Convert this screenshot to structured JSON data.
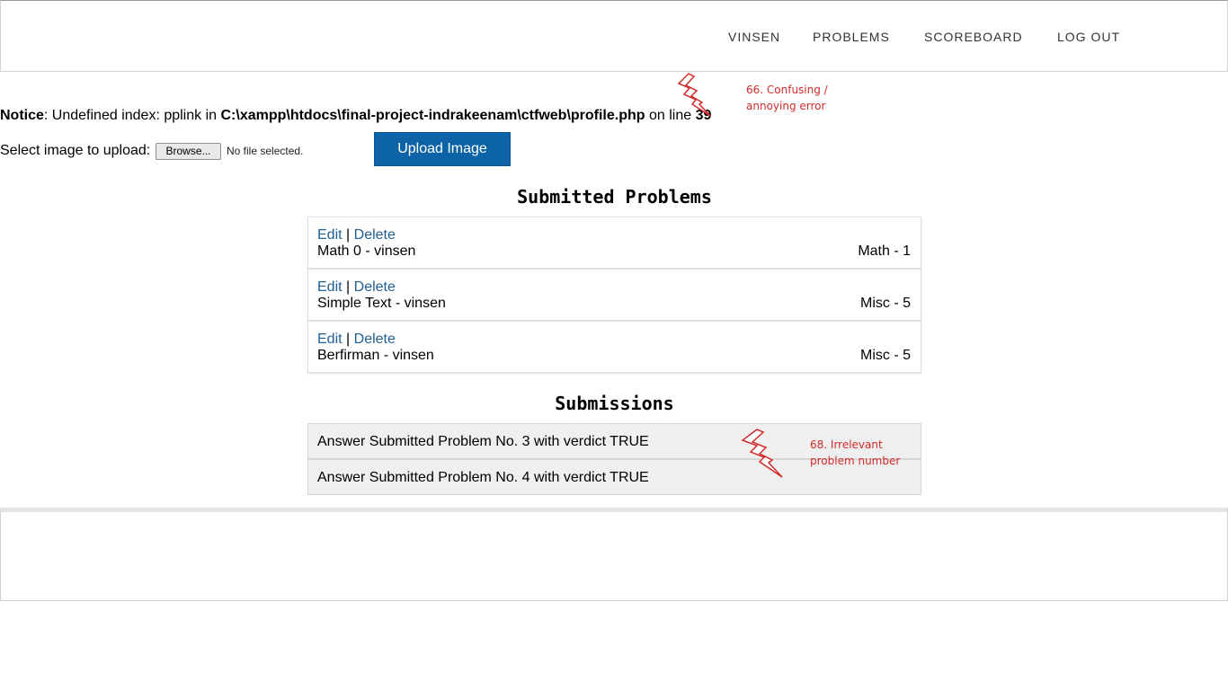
{
  "nav": {
    "items": [
      "VINSEN",
      "PROBLEMS",
      "SCOREBOARD",
      "LOG OUT"
    ]
  },
  "notice": {
    "label": "Notice",
    "message": ": Undefined index: pplink in ",
    "path": "C:\\xampp\\htdocs\\final-project-indrakeenam\\ctfweb\\profile.php",
    "on_line": " on line ",
    "line_number": "39"
  },
  "upload": {
    "label": "Select image to upload:",
    "browse_label": "Browse...",
    "file_status": "No file selected.",
    "button_label": "Upload Image"
  },
  "submitted_problems": {
    "title": "Submitted Problems",
    "edit_label": "Edit",
    "separator": "|",
    "delete_label": "Delete",
    "items": [
      {
        "name": "Math 0 - vinsen",
        "category": "Math - 1"
      },
      {
        "name": "Simple Text - vinsen",
        "category": "Misc - 5"
      },
      {
        "name": "Berfirman - vinsen",
        "category": "Misc - 5"
      }
    ]
  },
  "submissions": {
    "title": "Submissions",
    "items": [
      "Answer Submitted Problem No. 3 with verdict TRUE",
      "Answer Submitted Problem No. 4 with verdict TRUE"
    ]
  },
  "annotations": {
    "a66_line1": "66. Confusing /",
    "a66_line2": "annoying error",
    "a68_line1": "68. Irrelevant",
    "a68_line2": "problem number"
  },
  "colors": {
    "accent_blue": "#0c64a6",
    "link_blue": "#1f5f94",
    "annotation_red": "#d22b2b"
  },
  "icons": [
    "lightning-bolt-icon"
  ]
}
